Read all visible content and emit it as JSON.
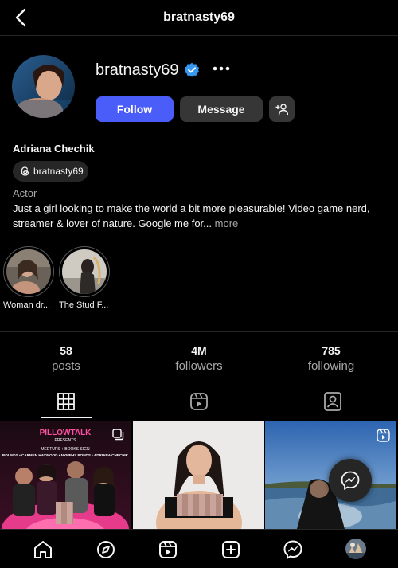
{
  "header": {
    "title": "bratnasty69"
  },
  "profile": {
    "username": "bratnasty69",
    "follow_label": "Follow",
    "message_label": "Message",
    "full_name": "Adriana Chechik",
    "threads_handle": "bratnasty69",
    "category": "Actor",
    "bio": "Just a girl looking to make the world a bit more pleasurable! Video game nerd, streamer & lover of nature. Google me for...",
    "bio_more": "more"
  },
  "highlights": [
    {
      "label": "Woman dr..."
    },
    {
      "label": "The Stud F..."
    }
  ],
  "stats": {
    "posts": {
      "value": "58",
      "label": "posts"
    },
    "followers": {
      "value": "4M",
      "label": "followers"
    },
    "following": {
      "value": "785",
      "label": "following"
    }
  },
  "tabs": [
    {
      "icon": "grid-icon",
      "active": true
    },
    {
      "icon": "reels-icon",
      "active": false
    },
    {
      "icon": "tagged-icon",
      "active": false
    }
  ],
  "grid": {
    "post1": {
      "brand": "PILLOWTALK",
      "presents": "PRESENTS",
      "subtitle": "MEETUPS + BOOKS SIGN",
      "names": "ROUNDS • CARMEN HAYWOOD • NYMPHS PONDS • ADRIANA CHECHIK"
    }
  },
  "colors": {
    "accent": "#4a5df9",
    "verified": "#3897f0",
    "background": "#000000",
    "secondary_text": "#a8a8a8",
    "button_gray": "#363636"
  },
  "bottom_nav": [
    {
      "icon": "home-icon"
    },
    {
      "icon": "explore-icon"
    },
    {
      "icon": "reels-icon"
    },
    {
      "icon": "new-post-icon"
    },
    {
      "icon": "messenger-icon"
    },
    {
      "icon": "profile-avatar"
    }
  ]
}
